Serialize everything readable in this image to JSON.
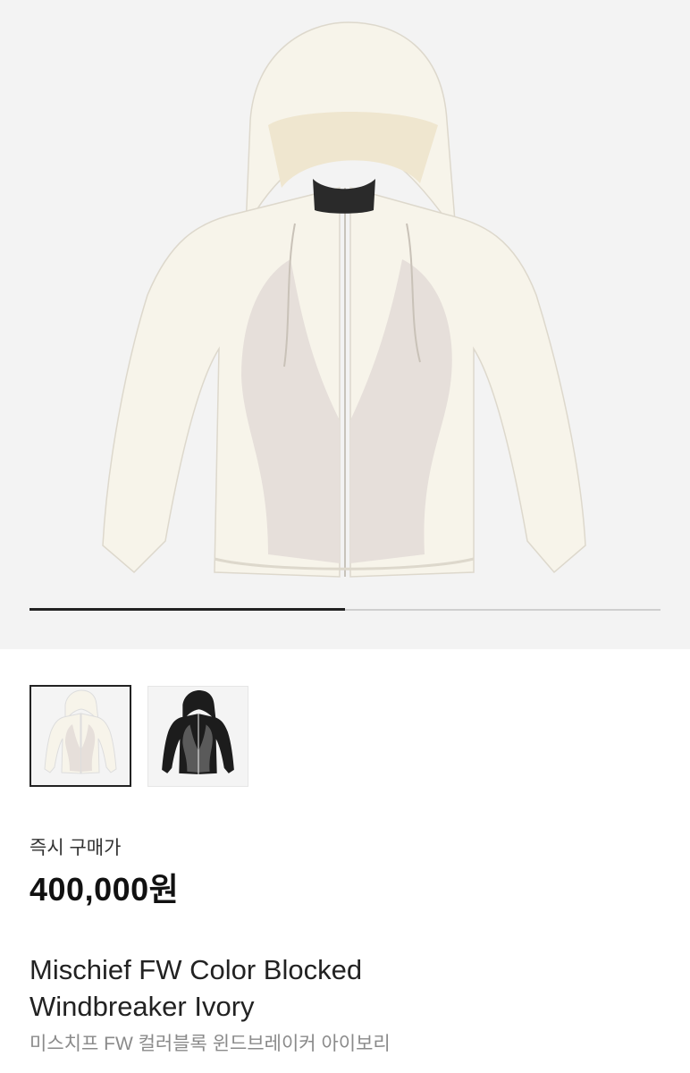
{
  "gallery": {
    "image_alt_main": "Mischief FW Color Blocked Windbreaker Ivory",
    "slide_progress": 0.5,
    "thumbnails": [
      {
        "name": "ivory",
        "selected": true
      },
      {
        "name": "black",
        "selected": false
      }
    ]
  },
  "product": {
    "price_label": "즉시 구매가",
    "price": "400,000원",
    "title_line1": "Mischief FW Color Blocked",
    "title_line2": "Windbreaker Ivory",
    "subtitle": "미스치프 FW 컬러블록 윈드브레이커 아이보리"
  },
  "colors": {
    "hero_bg": "#f3f3f3",
    "jacket_ivory": "#f7f4ea",
    "jacket_panel": "#e6dfda",
    "jacket_black": "#1c1c1c",
    "jacket_grey": "#5a5a5a"
  }
}
